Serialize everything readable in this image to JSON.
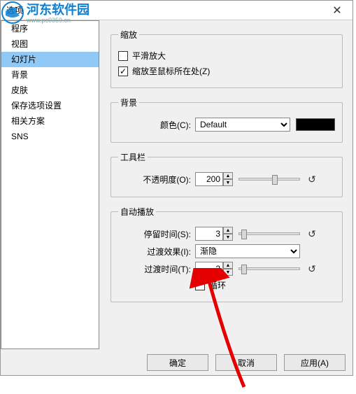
{
  "watermark": {
    "text1": "河东软件园",
    "url": "www.pc0359.cn"
  },
  "dialog": {
    "title": "选项",
    "close": "✕"
  },
  "sidebar": {
    "items": [
      {
        "label": "程序"
      },
      {
        "label": "视图"
      },
      {
        "label": "幻灯片",
        "active": true
      },
      {
        "label": "背景"
      },
      {
        "label": "皮肤"
      },
      {
        "label": "保存选项设置"
      },
      {
        "label": "相关方案"
      },
      {
        "label": "SNS"
      }
    ]
  },
  "groups": {
    "zoom": {
      "legend": "缩放",
      "smooth": {
        "label": "平滑放大",
        "checked": false
      },
      "cursor": {
        "label": "缩放至鼠标所在处(Z)",
        "checked": true
      }
    },
    "background": {
      "legend": "背景",
      "color_label": "颜色(C):",
      "color_value": "Default",
      "swatch": "#000000"
    },
    "toolbar": {
      "legend": "工具栏",
      "opacity_label": "不透明度(O):",
      "opacity_value": "200"
    },
    "autoplay": {
      "legend": "自动播放",
      "dwell_label": "停留时间(S):",
      "dwell_value": "3",
      "effect_label": "过渡效果(I):",
      "effect_value": "渐隐",
      "duration_label": "过渡时间(T):",
      "duration_value": "2",
      "loop_label": "循环",
      "loop_checked": false
    }
  },
  "buttons": {
    "ok": "确定",
    "cancel": "取消",
    "apply": "应用(A)"
  }
}
